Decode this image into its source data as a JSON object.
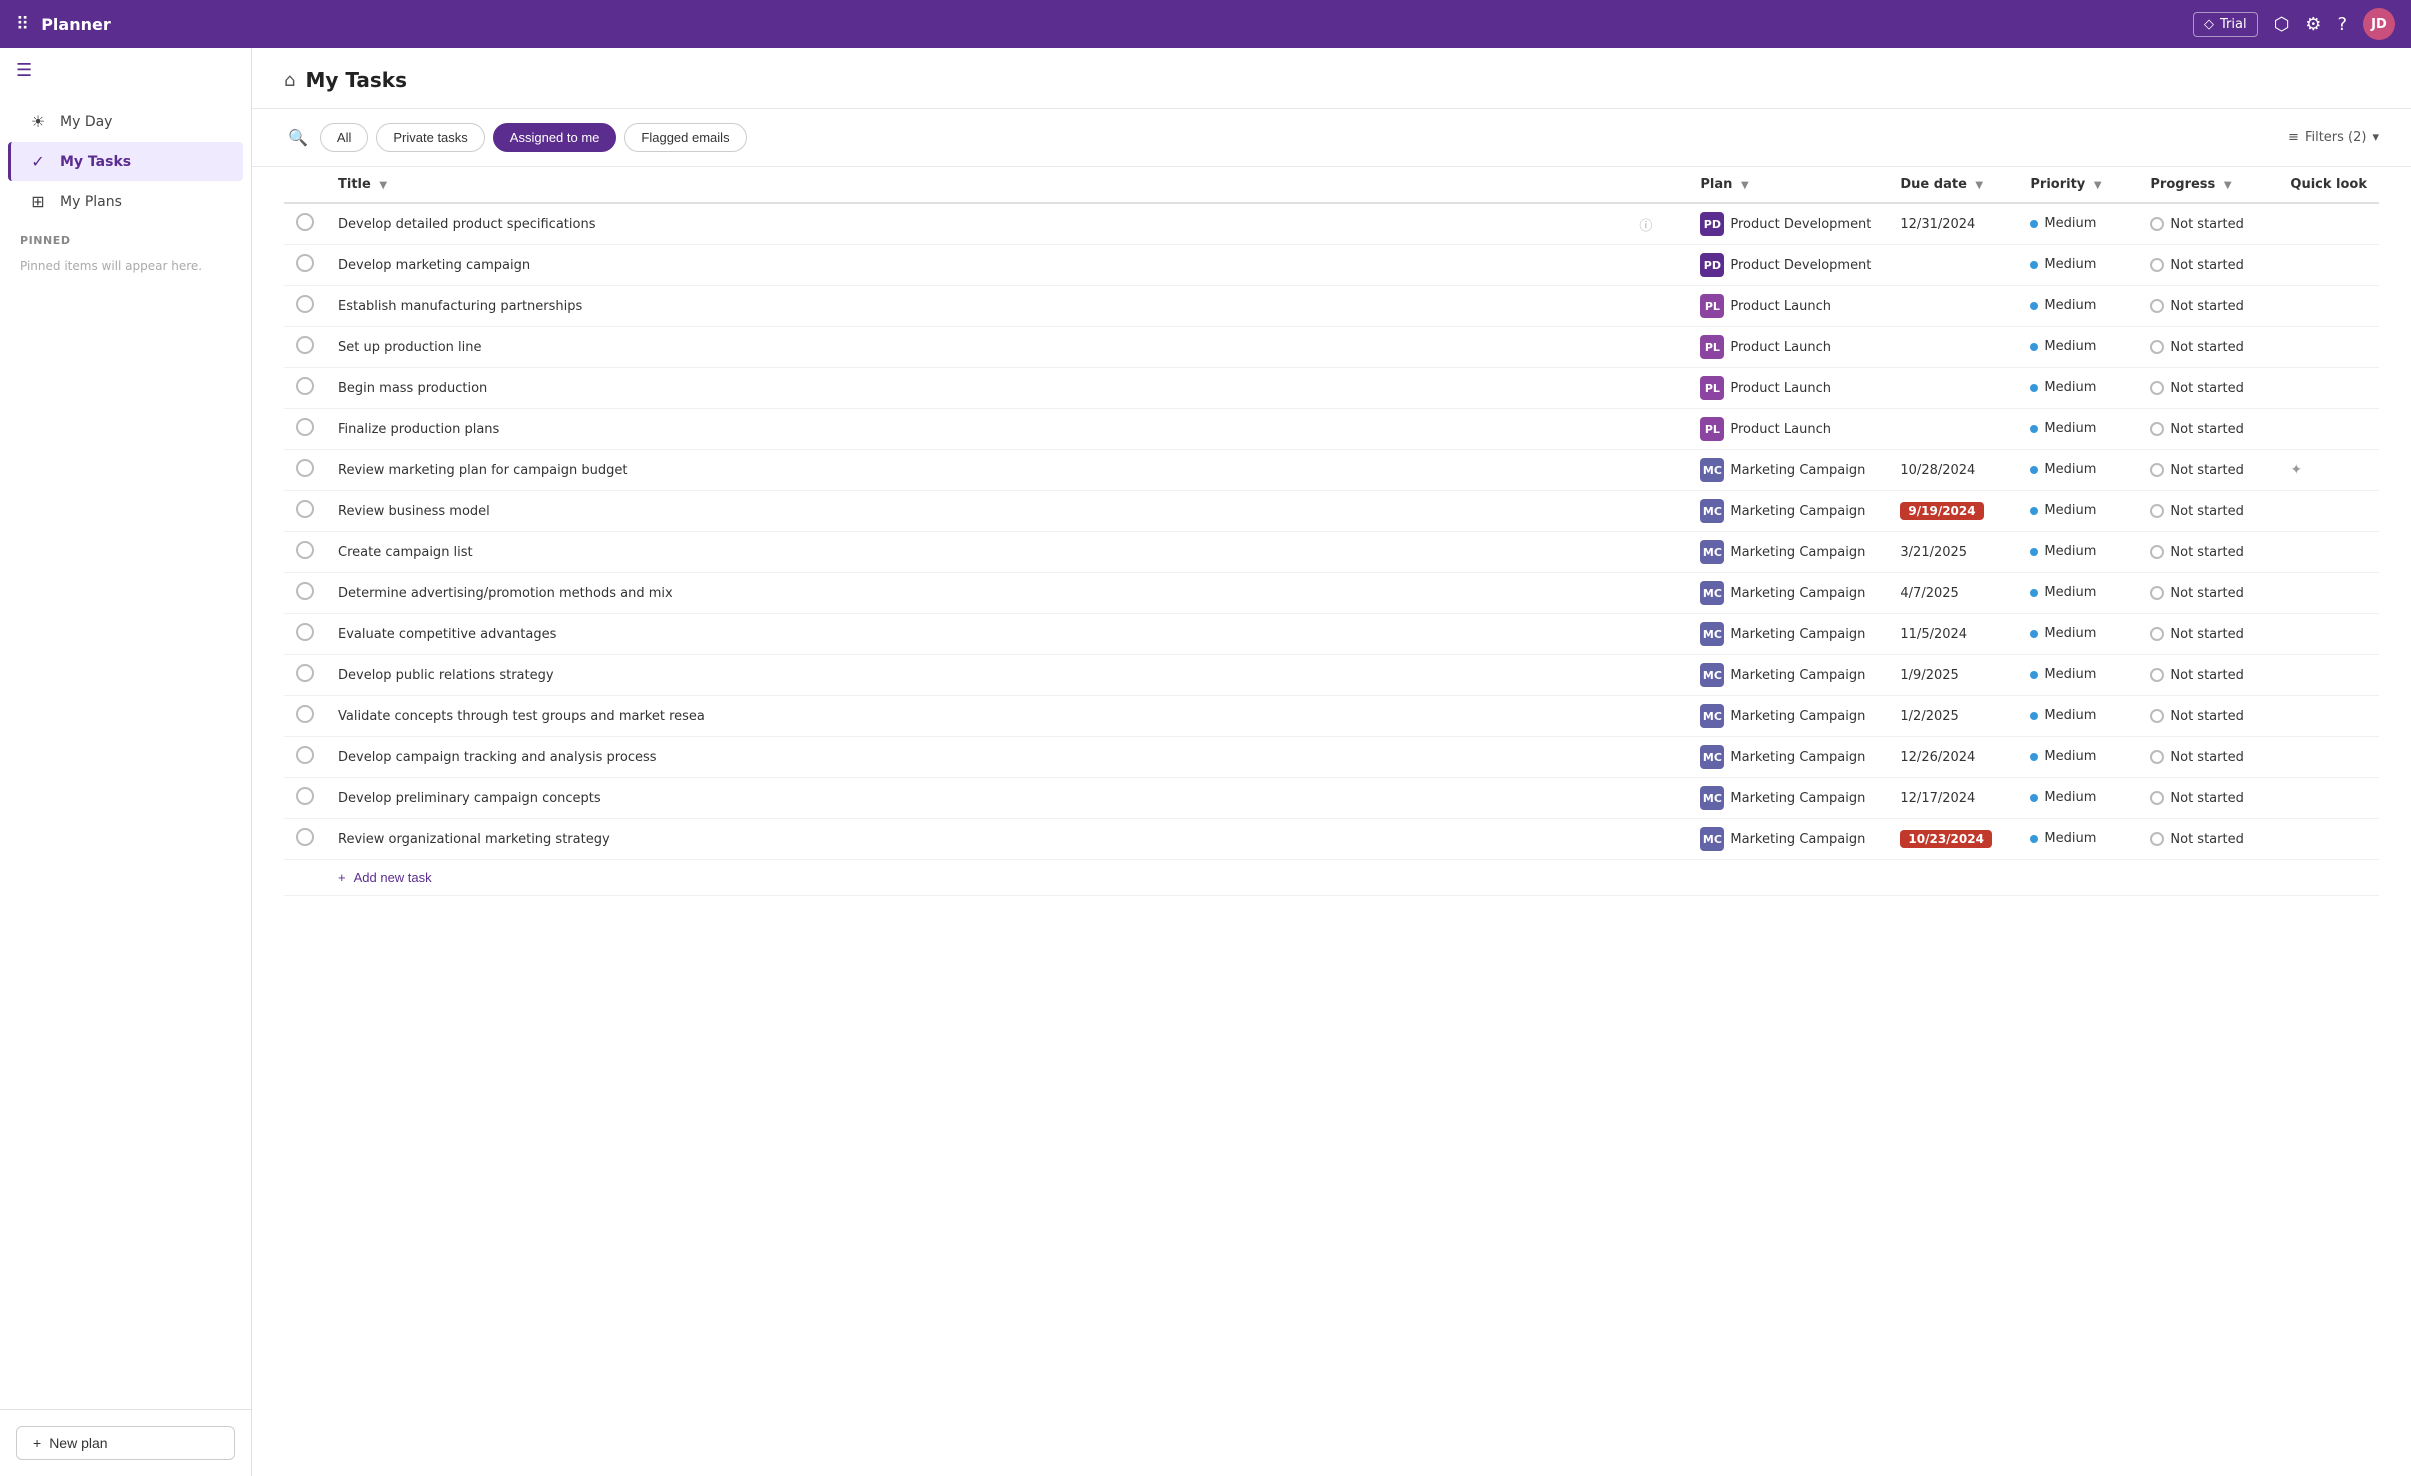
{
  "app": {
    "name": "Planner",
    "trial_label": "Trial",
    "avatar_initials": "JD"
  },
  "topbar": {
    "dots_icon": "⠿",
    "share_icon": "⬡",
    "settings_icon": "⚙",
    "help_icon": "?",
    "diamond_icon": "◇"
  },
  "sidebar": {
    "toggle_icon": "☰",
    "items": [
      {
        "id": "my-day",
        "label": "My Day",
        "icon": "☀",
        "active": false
      },
      {
        "id": "my-tasks",
        "label": "My Tasks",
        "icon": "✓",
        "active": true
      },
      {
        "id": "my-plans",
        "label": "My Plans",
        "icon": "⊞",
        "active": false
      }
    ],
    "pinned_label": "Pinned",
    "pinned_empty": "Pinned items will appear here.",
    "new_plan_label": "New plan",
    "new_plan_icon": "+"
  },
  "main": {
    "page_icon": "⌂",
    "title": "My Tasks",
    "filter_bar": {
      "search_icon": "🔍",
      "tabs": [
        {
          "id": "all",
          "label": "All",
          "active": false
        },
        {
          "id": "private-tasks",
          "label": "Private tasks",
          "active": false
        },
        {
          "id": "assigned-to-me",
          "label": "Assigned to me",
          "active": true
        },
        {
          "id": "flagged-emails",
          "label": "Flagged emails",
          "active": false
        }
      ],
      "filters_label": "Filters (2)",
      "filters_icon": "▾"
    },
    "table": {
      "columns": [
        {
          "id": "checkbox",
          "label": ""
        },
        {
          "id": "title",
          "label": "Title",
          "sortable": true
        },
        {
          "id": "plan",
          "label": "Plan",
          "sortable": true
        },
        {
          "id": "due-date",
          "label": "Due date",
          "sortable": true
        },
        {
          "id": "priority",
          "label": "Priority",
          "sortable": true
        },
        {
          "id": "progress",
          "label": "Progress",
          "sortable": true
        },
        {
          "id": "quick-look",
          "label": "Quick look",
          "sortable": false
        }
      ],
      "rows": [
        {
          "title": "Develop detailed product specifications",
          "plan_label": "Product Development",
          "plan_icon": "PD",
          "plan_color": "pd",
          "due_date": "12/31/2024",
          "due_overdue": false,
          "priority": "Medium",
          "progress": "Not started",
          "has_quick_look": false
        },
        {
          "title": "Develop marketing campaign",
          "plan_label": "Product Development",
          "plan_icon": "PD",
          "plan_color": "pd",
          "due_date": "",
          "due_overdue": false,
          "priority": "Medium",
          "progress": "Not started",
          "has_quick_look": false
        },
        {
          "title": "Establish manufacturing partnerships",
          "plan_label": "Product Launch",
          "plan_icon": "PL",
          "plan_color": "pl",
          "due_date": "",
          "due_overdue": false,
          "priority": "Medium",
          "progress": "Not started",
          "has_quick_look": false
        },
        {
          "title": "Set up production line",
          "plan_label": "Product Launch",
          "plan_icon": "PL",
          "plan_color": "pl",
          "due_date": "",
          "due_overdue": false,
          "priority": "Medium",
          "progress": "Not started",
          "has_quick_look": false
        },
        {
          "title": "Begin mass production",
          "plan_label": "Product Launch",
          "plan_icon": "PL",
          "plan_color": "pl",
          "due_date": "",
          "due_overdue": false,
          "priority": "Medium",
          "progress": "Not started",
          "has_quick_look": false
        },
        {
          "title": "Finalize production plans",
          "plan_label": "Product Launch",
          "plan_icon": "PL",
          "plan_color": "pl",
          "due_date": "",
          "due_overdue": false,
          "priority": "Medium",
          "progress": "Not started",
          "has_quick_look": false
        },
        {
          "title": "Review marketing plan for campaign budget",
          "plan_label": "Marketing Campaign",
          "plan_icon": "MC",
          "plan_color": "mc",
          "due_date": "10/28/2024",
          "due_overdue": false,
          "priority": "Medium",
          "progress": "Not started",
          "has_quick_look": true
        },
        {
          "title": "Review business model",
          "plan_label": "Marketing Campaign",
          "plan_icon": "MC",
          "plan_color": "mc",
          "due_date": "9/19/2024",
          "due_overdue": true,
          "priority": "Medium",
          "progress": "Not started",
          "has_quick_look": false
        },
        {
          "title": "Create campaign list",
          "plan_label": "Marketing Campaign",
          "plan_icon": "MC",
          "plan_color": "mc",
          "due_date": "3/21/2025",
          "due_overdue": false,
          "priority": "Medium",
          "progress": "Not started",
          "has_quick_look": false
        },
        {
          "title": "Determine advertising/promotion methods and mix",
          "plan_label": "Marketing Campaign",
          "plan_icon": "MC",
          "plan_color": "mc",
          "due_date": "4/7/2025",
          "due_overdue": false,
          "priority": "Medium",
          "progress": "Not started",
          "has_quick_look": false
        },
        {
          "title": "Evaluate competitive advantages",
          "plan_label": "Marketing Campaign",
          "plan_icon": "MC",
          "plan_color": "mc",
          "due_date": "11/5/2024",
          "due_overdue": false,
          "priority": "Medium",
          "progress": "Not started",
          "has_quick_look": false
        },
        {
          "title": "Develop public relations strategy",
          "plan_label": "Marketing Campaign",
          "plan_icon": "MC",
          "plan_color": "mc",
          "due_date": "1/9/2025",
          "due_overdue": false,
          "priority": "Medium",
          "progress": "Not started",
          "has_quick_look": false
        },
        {
          "title": "Validate concepts through test groups and market resea",
          "plan_label": "Marketing Campaign",
          "plan_icon": "MC",
          "plan_color": "mc",
          "due_date": "1/2/2025",
          "due_overdue": false,
          "priority": "Medium",
          "progress": "Not started",
          "has_quick_look": false
        },
        {
          "title": "Develop campaign tracking and analysis process",
          "plan_label": "Marketing Campaign",
          "plan_icon": "MC",
          "plan_color": "mc",
          "due_date": "12/26/2024",
          "due_overdue": false,
          "priority": "Medium",
          "progress": "Not started",
          "has_quick_look": false
        },
        {
          "title": "Develop preliminary campaign concepts",
          "plan_label": "Marketing Campaign",
          "plan_icon": "MC",
          "plan_color": "mc",
          "due_date": "12/17/2024",
          "due_overdue": false,
          "priority": "Medium",
          "progress": "Not started",
          "has_quick_look": false
        },
        {
          "title": "Review organizational marketing strategy",
          "plan_label": "Marketing Campaign",
          "plan_icon": "MC",
          "plan_color": "mc",
          "due_date": "10/23/2024",
          "due_overdue": true,
          "priority": "Medium",
          "progress": "Not started",
          "has_quick_look": false
        }
      ],
      "add_task_label": "Add new task"
    }
  }
}
